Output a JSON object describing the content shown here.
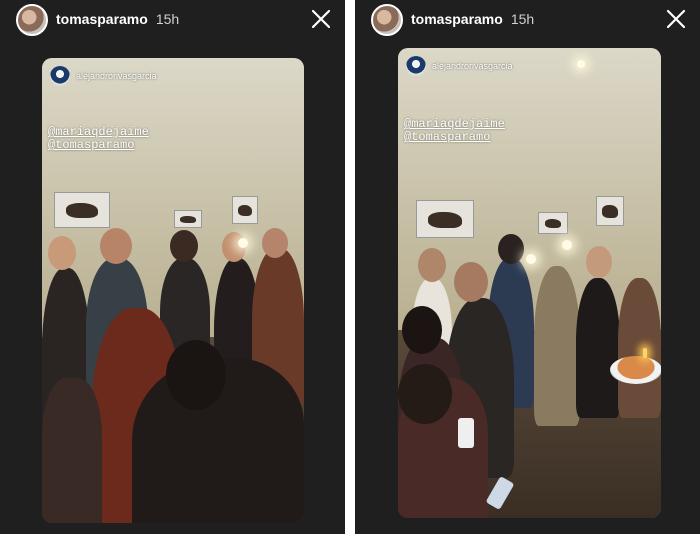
{
  "stories": [
    {
      "header": {
        "username": "tomasparamo",
        "time": "15h",
        "close_icon": "close-icon"
      },
      "repost": {
        "username": "alejandrorivasgarcia"
      },
      "mentions": [
        "@mariaqdejaime",
        "@tomasparamo"
      ]
    },
    {
      "header": {
        "username": "tomasparamo",
        "time": "15h",
        "close_icon": "close-icon"
      },
      "repost": {
        "username": "alejandrorivasgarcia"
      },
      "mentions": [
        "@mariaqdejaime",
        "@tomasparamo"
      ]
    }
  ],
  "colors": {
    "panel_bg": "#1f1f1f",
    "text": "#ffffff",
    "time_text": "#d0d0d0"
  }
}
